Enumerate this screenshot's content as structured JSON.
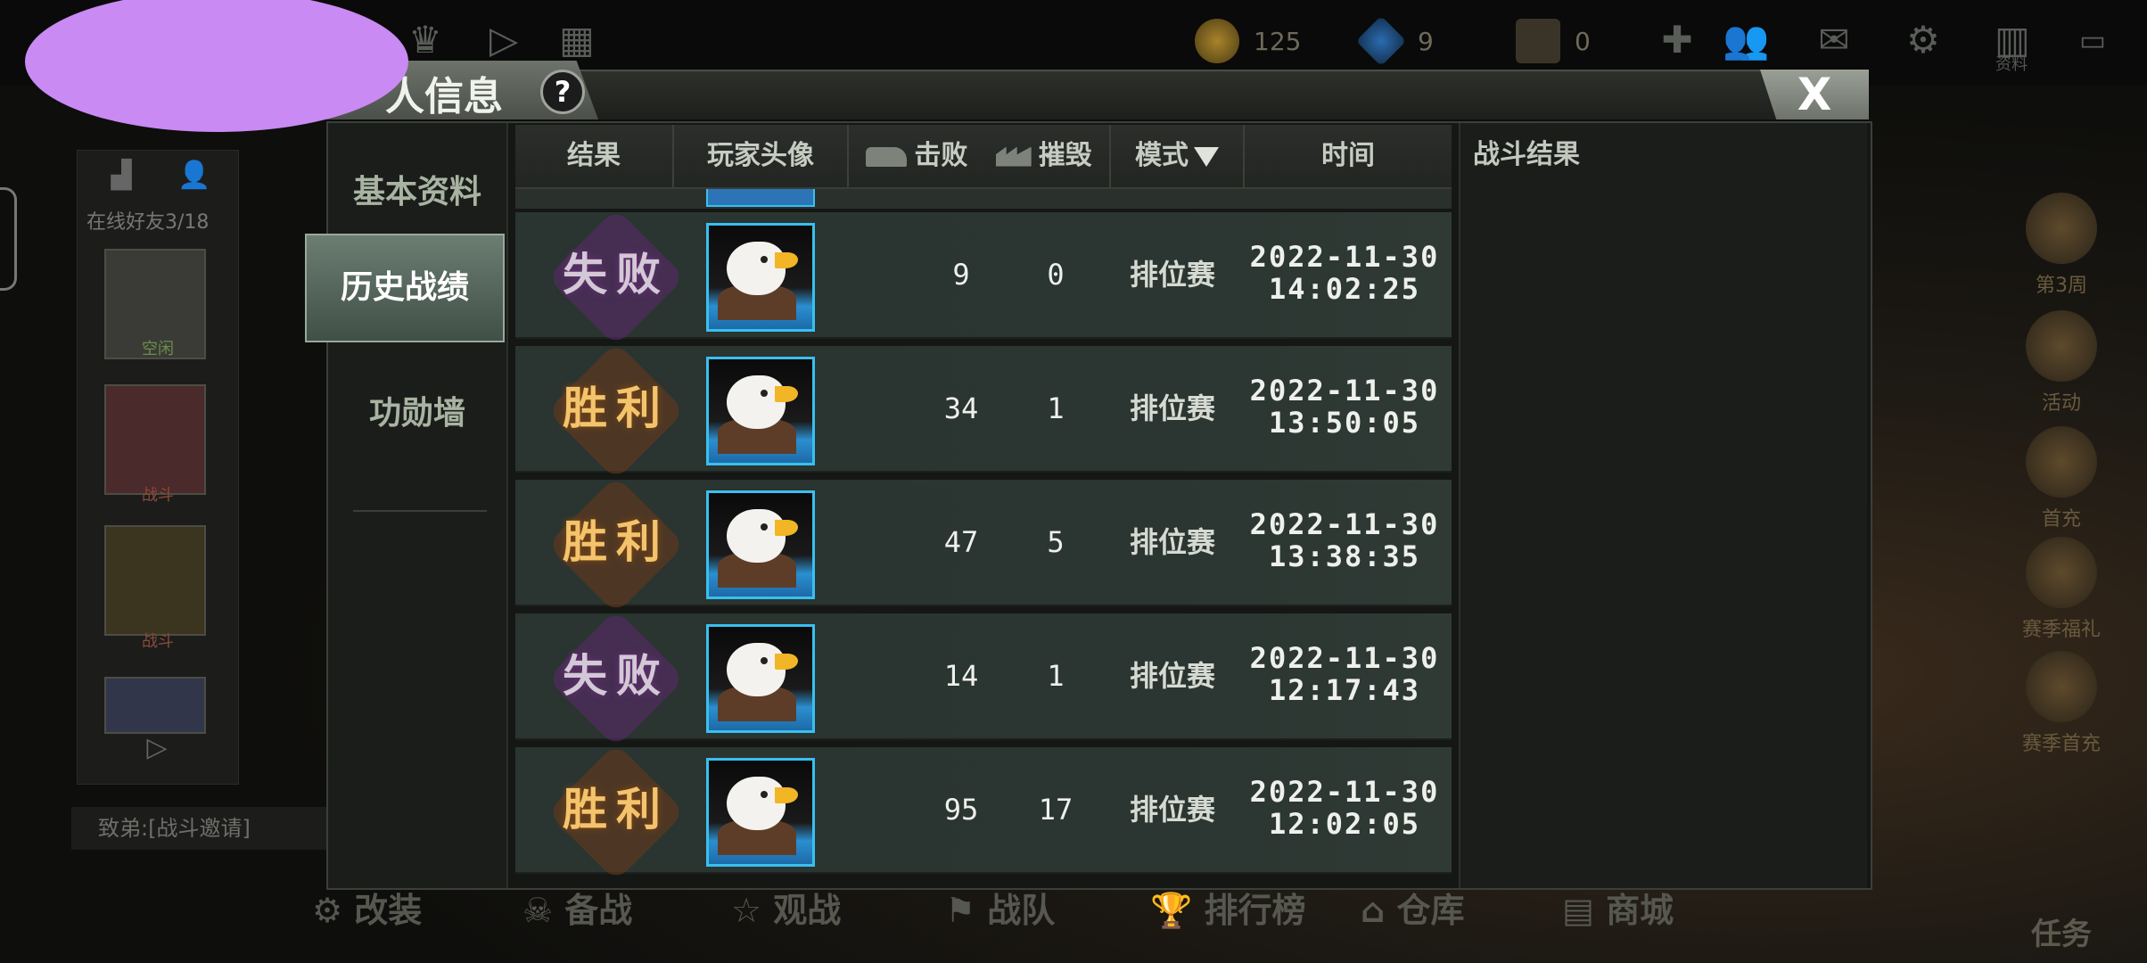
{
  "top_bar": {
    "gold": "125",
    "diamond": "9",
    "ticket": "0",
    "profile_label": "资料"
  },
  "friends_panel": {
    "online_count": "在线好友3/18",
    "friends": [
      {
        "status": "空闲"
      },
      {
        "status": "战斗"
      },
      {
        "status": "战斗"
      }
    ],
    "chat_preview": "致弟:[战斗邀请]"
  },
  "right_menu": [
    "第3周",
    "活动",
    "首充",
    "赛季福礼",
    "赛季首充"
  ],
  "bottom_nav": [
    "改装",
    "备战",
    "观战",
    "战队",
    "排行榜",
    "仓库",
    "商城"
  ],
  "bottom_right_label": "任务",
  "dialog": {
    "title": "人信息",
    "help": "?",
    "close": "X",
    "side_tabs": [
      "基本资料",
      "历史战绩",
      "功勋墙"
    ],
    "active_tab": "历史战绩",
    "columns": {
      "result": "结果",
      "avatar": "玩家头像",
      "kills": "击败",
      "destroy": "摧毁",
      "mode": "模式",
      "time": "时间"
    },
    "rows": [
      {
        "result": "失败",
        "type": "lose",
        "kills": "9",
        "destroy": "0",
        "mode": "排位赛",
        "date": "2022-11-30",
        "clock": "14:02:25"
      },
      {
        "result": "胜利",
        "type": "win",
        "kills": "34",
        "destroy": "1",
        "mode": "排位赛",
        "date": "2022-11-30",
        "clock": "13:50:05"
      },
      {
        "result": "胜利",
        "type": "win",
        "kills": "47",
        "destroy": "5",
        "mode": "排位赛",
        "date": "2022-11-30",
        "clock": "13:38:35"
      },
      {
        "result": "失败",
        "type": "lose",
        "kills": "14",
        "destroy": "1",
        "mode": "排位赛",
        "date": "2022-11-30",
        "clock": "12:17:43"
      },
      {
        "result": "胜利",
        "type": "win",
        "kills": "95",
        "destroy": "17",
        "mode": "排位赛",
        "date": "2022-11-30",
        "clock": "12:02:05"
      }
    ],
    "result_panel_title": "战斗结果"
  },
  "colors": {
    "win": "#f3c46c",
    "lose": "#d2c8d6",
    "avatar_border": "#38c0f0",
    "privacy_mask": "#c98af3"
  }
}
